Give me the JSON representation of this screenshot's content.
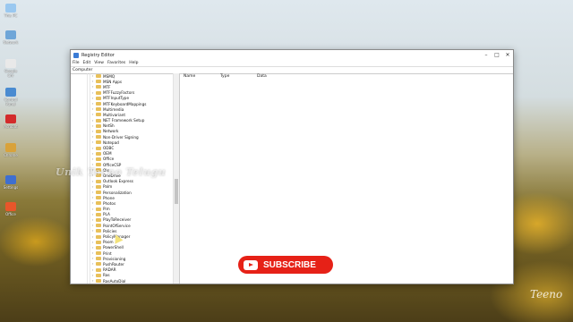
{
  "desktop": {
    "icons": [
      {
        "label": "This PC",
        "color": "#9ac8f0"
      },
      {
        "label": "Network",
        "color": "#6fa6d8"
      },
      {
        "label": "Google Chr",
        "color": "#e9e9e9"
      },
      {
        "label": "Control Panel",
        "color": "#4a8bd1"
      },
      {
        "label": "Acrobat",
        "color": "#d32b2b"
      },
      {
        "label": "Chrome",
        "color": "#d9a23a"
      },
      {
        "label": "Settings",
        "color": "#3f6fd0"
      },
      {
        "label": "Office",
        "color": "#e8562a"
      }
    ]
  },
  "window": {
    "title": "Registry Editor",
    "controls": {
      "minimize": "–",
      "maximize": "□",
      "close": "✕"
    },
    "menu": [
      "File",
      "Edit",
      "View",
      "Favorites",
      "Help"
    ],
    "address": "Computer",
    "tree_items": [
      "MSMQ",
      "MSN Apps",
      "MTF",
      "MTFFuzzyFactors",
      "MTFInputType",
      "MTFKeyboardMappings",
      "Multimedia",
      "Multivariant",
      "NET Framework Setup",
      "NetSh",
      "Network",
      "Non-Driver Signing",
      "Notepad",
      "ODBC",
      "OEM",
      "Office",
      "OfficeCSP",
      "Ole",
      "OneDrive",
      "Outlook Express",
      "Palm",
      "Personalization",
      "Phone",
      "Photos",
      "Pim",
      "PLA",
      "PlayToReceiver",
      "PointOfService",
      "Policies",
      "PolicyManager",
      "Poom",
      "PowerShell",
      "Print",
      "Provisioning",
      "PushRouter",
      "RADAR",
      "Ras",
      "RasAutoDial"
    ],
    "columns": {
      "name": "Name",
      "type": "Type",
      "data": "Data"
    }
  },
  "overlay": {
    "subscribe_label": "SUBSCRIBE",
    "watermark": "Unik Tecno Telugu",
    "brand": "Teeno"
  }
}
